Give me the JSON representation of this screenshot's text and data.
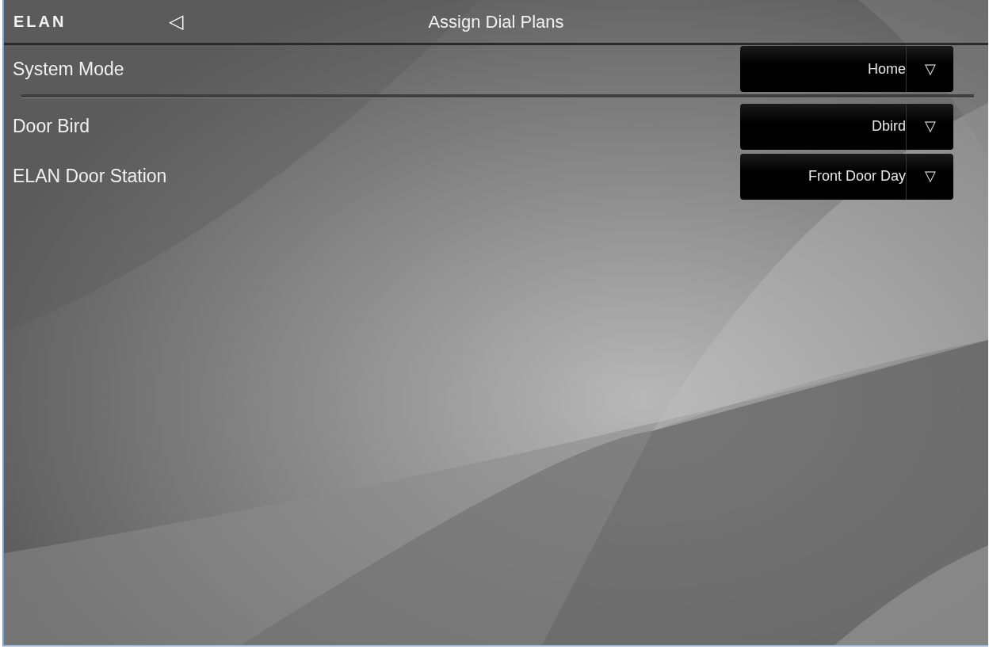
{
  "header": {
    "logo": "ELAN",
    "back": "◁",
    "title": "Assign Dial Plans"
  },
  "mode_row": {
    "label": "System Mode",
    "value": "Home",
    "arrow": "▽"
  },
  "rows": [
    {
      "label": "Door Bird",
      "value": "Dbird",
      "arrow": "▽"
    },
    {
      "label": "ELAN Door Station",
      "value": "Front Door Day",
      "arrow": "▽"
    }
  ]
}
